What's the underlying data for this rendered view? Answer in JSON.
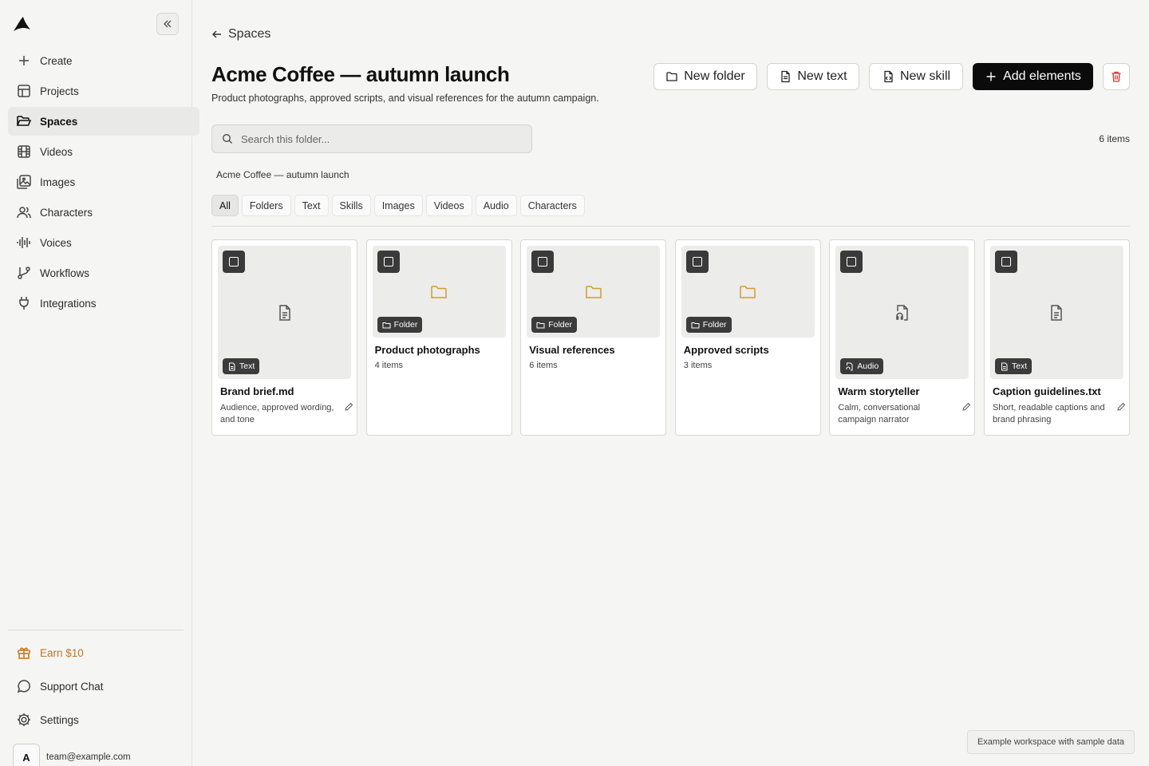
{
  "sidebar": {
    "logo_icon": "logo-icon",
    "collapse_icon": "chevrons-left-icon",
    "items": [
      {
        "label": "Create",
        "icon": "plus-icon"
      },
      {
        "label": "Projects",
        "icon": "layout-icon"
      },
      {
        "label": "Spaces",
        "icon": "folder-open-icon",
        "active": true
      },
      {
        "label": "Videos",
        "icon": "film-icon"
      },
      {
        "label": "Images",
        "icon": "images-icon"
      },
      {
        "label": "Characters",
        "icon": "users-icon"
      },
      {
        "label": "Voices",
        "icon": "audio-lines-icon"
      },
      {
        "label": "Workflows",
        "icon": "git-branch-icon"
      },
      {
        "label": "Integrations",
        "icon": "plug-icon"
      }
    ],
    "bottom": {
      "earn": "Earn $10",
      "support": "Support Chat",
      "settings": "Settings"
    },
    "user": {
      "avatar": "A",
      "email": "team@example.com"
    }
  },
  "header": {
    "back_label": "Spaces",
    "title": "Acme Coffee — autumn launch",
    "subtitle": "Product photographs, approved scripts, and visual references for the autumn campaign.",
    "buttons": {
      "new_folder": "New folder",
      "new_text": "New text",
      "new_skill": "New skill",
      "add_elements": "Add elements"
    }
  },
  "search": {
    "placeholder": "Search this folder..."
  },
  "item_count": "6 items",
  "breadcrumb": "Acme Coffee — autumn launch",
  "filters": [
    "All",
    "Folders",
    "Text",
    "Skills",
    "Images",
    "Videos",
    "Audio",
    "Characters"
  ],
  "active_filter": "All",
  "colors": {
    "accent": "#0b0b0b",
    "folder": "#d69a2d",
    "earn": "#c7741a",
    "delete": "#d0342c"
  },
  "cards": [
    {
      "kind": "text",
      "badge": "Text",
      "name": "Brand brief.md",
      "desc": "Audience, approved wording, and tone"
    },
    {
      "kind": "folder",
      "badge": "Folder",
      "name": "Product photographs",
      "meta": "4 items"
    },
    {
      "kind": "folder",
      "badge": "Folder",
      "name": "Visual references",
      "meta": "6 items"
    },
    {
      "kind": "folder",
      "badge": "Folder",
      "name": "Approved scripts",
      "meta": "3 items"
    },
    {
      "kind": "audio",
      "badge": "Audio",
      "name": "Warm storyteller",
      "desc": "Calm, conversational campaign narrator"
    },
    {
      "kind": "text",
      "badge": "Text",
      "name": "Caption guidelines.txt",
      "desc": "Short, readable captions and brand phrasing"
    }
  ],
  "footer_note": "Example workspace with sample data"
}
